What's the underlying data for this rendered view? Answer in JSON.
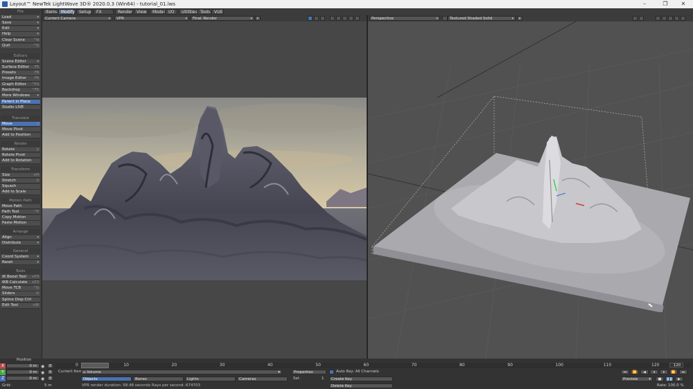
{
  "window": {
    "title": "Layout™ NewTek LightWave 3D® 2020.0.3 (Win64) - tutorial_01.lws"
  },
  "tabs": [
    "Items",
    "Modify",
    "Setup",
    "FX Tools",
    "Render",
    "View",
    "Model",
    "I/O",
    "Utilities",
    "Tools",
    "VUE"
  ],
  "sidebar": {
    "file_header": "File",
    "file_items": [
      {
        "label": "Load",
        "dd": "▾"
      },
      {
        "label": "Save",
        "dd": "▾"
      },
      {
        "label": "Edit",
        "dd": "▾"
      },
      {
        "label": "Help",
        "dd": "▾"
      },
      {
        "label": "Clear Scene",
        "sc": "^N"
      },
      {
        "label": "Quit",
        "sc": "^Q"
      }
    ],
    "editors_header": "Editors",
    "editors_items": [
      {
        "label": "Scene Editor",
        "dd": "▾"
      },
      {
        "label": "Surface Editor",
        "sc": "F5"
      },
      {
        "label": "Presets",
        "sc": "F8"
      },
      {
        "label": "Image Editor",
        "sc": "F6"
      },
      {
        "label": "Graph Editor",
        "sc": "^F2"
      },
      {
        "label": "Backdrop",
        "sc": "^F5"
      },
      {
        "label": "More Windows",
        "dd": "▾"
      },
      {
        "label": "Parent in Place",
        "hl": true
      },
      {
        "label": "Studio LIVE"
      }
    ],
    "translate_header": "Translate",
    "translate_items": [
      {
        "label": "Move",
        "sc": "t",
        "hl": true
      },
      {
        "label": "Move Pivot"
      },
      {
        "label": "Add to Position"
      }
    ],
    "rotate_header": "Rotate",
    "rotate_items": [
      {
        "label": "Rotate",
        "sc": "y"
      },
      {
        "label": "Rotate Pivot"
      },
      {
        "label": "Add to Rotation"
      }
    ],
    "transform_header": "Transform",
    "transform_items": [
      {
        "label": "Size",
        "sc": "+H"
      },
      {
        "label": "Stretch",
        "sc": "h"
      },
      {
        "label": "Squash"
      },
      {
        "label": "Add to Scale"
      }
    ],
    "motionpath_header": "Motion Path",
    "motionpath_items": [
      {
        "label": "Move Path"
      },
      {
        "label": "Path Tool",
        "sc": "^P"
      },
      {
        "label": "Copy Motion"
      },
      {
        "label": "Paste Motion"
      }
    ],
    "arrange_header": "Arrange",
    "arrange_items": [
      {
        "label": "Align",
        "dd": "▾"
      },
      {
        "label": "Distribute",
        "dd": "▾"
      }
    ],
    "general_header": "General",
    "general_items": [
      {
        "label": "Coord System",
        "dd": "▾"
      },
      {
        "label": "Reset",
        "dd": "▾"
      }
    ],
    "tools_header": "Tools",
    "tools_items": [
      {
        "label": "IK Boost Tool",
        "sc": "+F3"
      },
      {
        "label": "IKB Calculate",
        "sc": "+F2"
      },
      {
        "label": "Move TCB",
        "sc": "^G"
      },
      {
        "label": "Sliders",
        "sc": "D"
      },
      {
        "label": "Spline Disp Ctrl"
      },
      {
        "label": "Edit Tool",
        "sc": "+W"
      }
    ]
  },
  "viewport_left": {
    "camera": "Current Camera",
    "mode": "VPR",
    "render_preset": "Final_Render"
  },
  "viewport_right": {
    "view": "Perspective",
    "shading": "Textured Shaded Solid"
  },
  "timeline": {
    "ticks": [
      "0",
      "10",
      "20",
      "30",
      "40",
      "50",
      "60",
      "70",
      "80",
      "90",
      "100",
      "110",
      "120"
    ],
    "end_frame": "120",
    "start_frame": "0"
  },
  "bottom": {
    "position_label": "Position",
    "x_label": "X",
    "y_label": "Y",
    "z_label": "Z",
    "x_value": "0 m",
    "y_value": "0 m",
    "z_value": "0 m",
    "grid_label": "Grid:",
    "grid_value": "5 m",
    "current_item_label": "Current Item",
    "current_item_value": "Volume",
    "objects_btn": "Objects",
    "bones_btn": "Bones",
    "lights_btn": "Lights",
    "cameras_btn": "Cameras",
    "properties_btn": "Properties",
    "sel_label": "Sel:",
    "sel_value": "1",
    "autokey_label": "Auto Key: All Channels",
    "create_key_btn": "Create Key",
    "delete_key_btn": "Delete Key",
    "status_text": "VPR render duration: 58.48 seconds  Rays per second: 674703",
    "preview_label": "Preview",
    "rate_label": "Rate:",
    "rate_value": "100.0 %",
    "step_value": "1"
  },
  "colors": {
    "accent": "#4a73b0",
    "sidebar_bg": "#3e3e3e",
    "viewport_bg": "#474747"
  }
}
